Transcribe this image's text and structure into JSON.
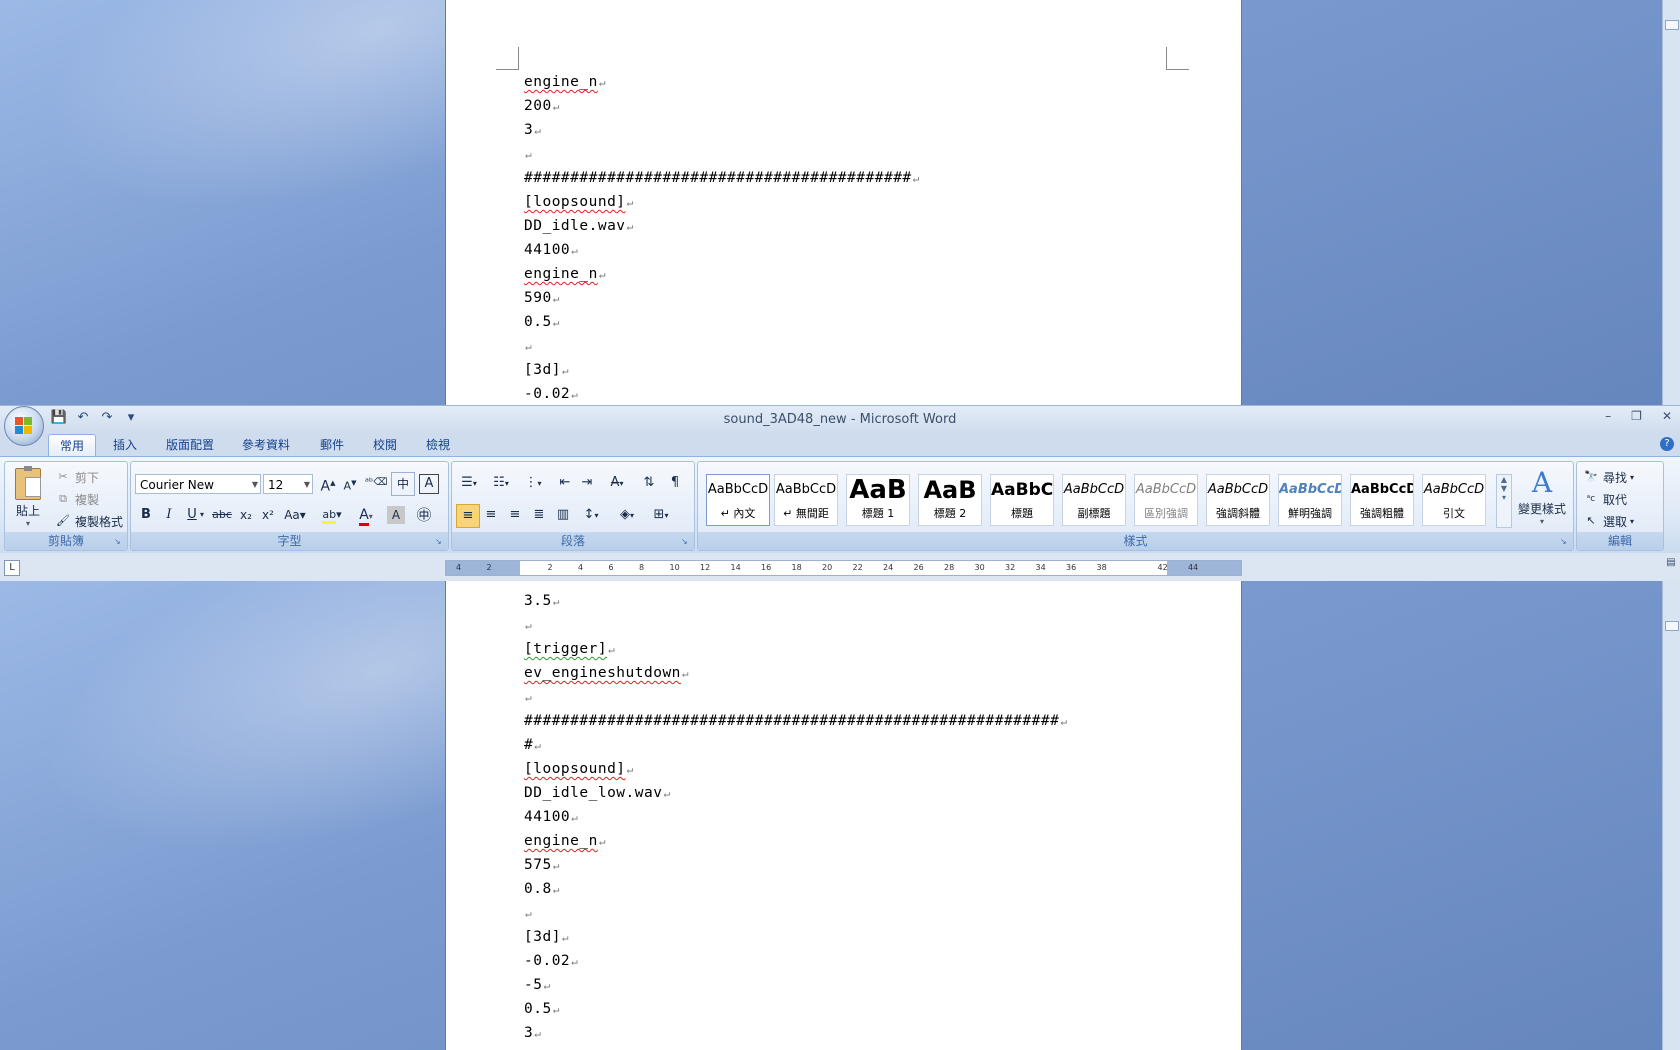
{
  "window": {
    "title": "sound_3AD48_new - Microsoft Word",
    "controls": [
      "–",
      "❐",
      "✕"
    ]
  },
  "qat": [
    "💾",
    "↶",
    "↷",
    "▾"
  ],
  "tabs": [
    "常用",
    "插入",
    "版面配置",
    "參考資料",
    "郵件",
    "校閱",
    "檢視"
  ],
  "clipboard": {
    "paste": "貼上",
    "cut": "剪下",
    "copy": "複製",
    "format_painter": "複製格式",
    "label": "剪貼簿"
  },
  "font": {
    "name": "Courier New",
    "size": "12",
    "label": "字型"
  },
  "paragraph": {
    "label": "段落"
  },
  "styles": {
    "label": "樣式",
    "items": [
      {
        "sample": "AaBbCcD",
        "name": "↵ 內文"
      },
      {
        "sample": "AaBbCcD",
        "name": "↵ 無間距"
      },
      {
        "sample": "AaB",
        "name": "標題 1"
      },
      {
        "sample": "AaB",
        "name": "標題 2"
      },
      {
        "sample": "AaBbC",
        "name": "標題"
      },
      {
        "sample": "AaBbCcD",
        "name": "副標題"
      },
      {
        "sample": "AaBbCcD",
        "name": "區別強調"
      },
      {
        "sample": "AaBbCcD",
        "name": "強調斜體"
      },
      {
        "sample": "AaBbCcD",
        "name": "鮮明強調"
      },
      {
        "sample": "AaBbCcD",
        "name": "強調粗體"
      },
      {
        "sample": "AaBbCcD",
        "name": "引文"
      }
    ],
    "change_styles": "變更樣式"
  },
  "editing": {
    "label": "編輯",
    "find": "尋找",
    "replace": "取代",
    "select": "選取"
  },
  "ruler_ticks": [
    "4",
    "2",
    "",
    "2",
    "4",
    "6",
    "8",
    "10",
    "12",
    "14",
    "16",
    "18",
    "20",
    "22",
    "24",
    "26",
    "28",
    "30",
    "32",
    "34",
    "36",
    "38",
    "",
    "42",
    "44"
  ],
  "doc_top": [
    "engine_n",
    "200",
    "3",
    "",
    "##########################################",
    "[loopsound]",
    "DD_idle.wav",
    "44100",
    "engine_n",
    "590",
    "0.5",
    "",
    "[3d]",
    "-0.02"
  ],
  "doc_bottom": [
    "3.5",
    "",
    "[trigger]",
    "ev_engineshutdown",
    "",
    "##########################################################",
    "#",
    "[loopsound]",
    "DD_idle_low.wav",
    "44100",
    "engine_n",
    "575",
    "0.8",
    "",
    "[3d]",
    "-0.02",
    "-5",
    "0.5",
    "3"
  ]
}
